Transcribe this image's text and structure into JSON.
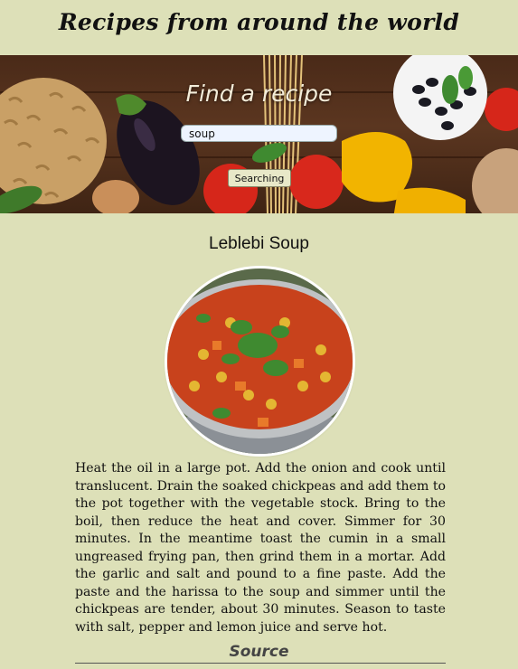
{
  "header": {
    "title": "Recipes from around the world"
  },
  "hero": {
    "heading": "Find a recipe",
    "search_value": "soup",
    "search_button": "Searching"
  },
  "recipe": {
    "title": "Leblebi Soup",
    "instructions": "Heat the oil in a large pot. Add the onion and cook until translucent. Drain the soaked chickpeas and add them to the pot together with the vegetable stock. Bring to the boil, then reduce the heat and cover. Simmer for 30 minutes. In the meantime toast the cumin in a small ungreased frying pan, then grind them in a mortar. Add the garlic and salt and pound to a fine paste. Add the paste and the harissa to the soup and simmer until the chickpeas are tender, about 30 minutes. Season to taste with salt, pepper and lemon juice and serve hot.",
    "source_label": "Source"
  },
  "colors": {
    "page_background": "#dde0b8",
    "hero_wood": "#4a2a18",
    "soup_red": "#c8421c"
  }
}
